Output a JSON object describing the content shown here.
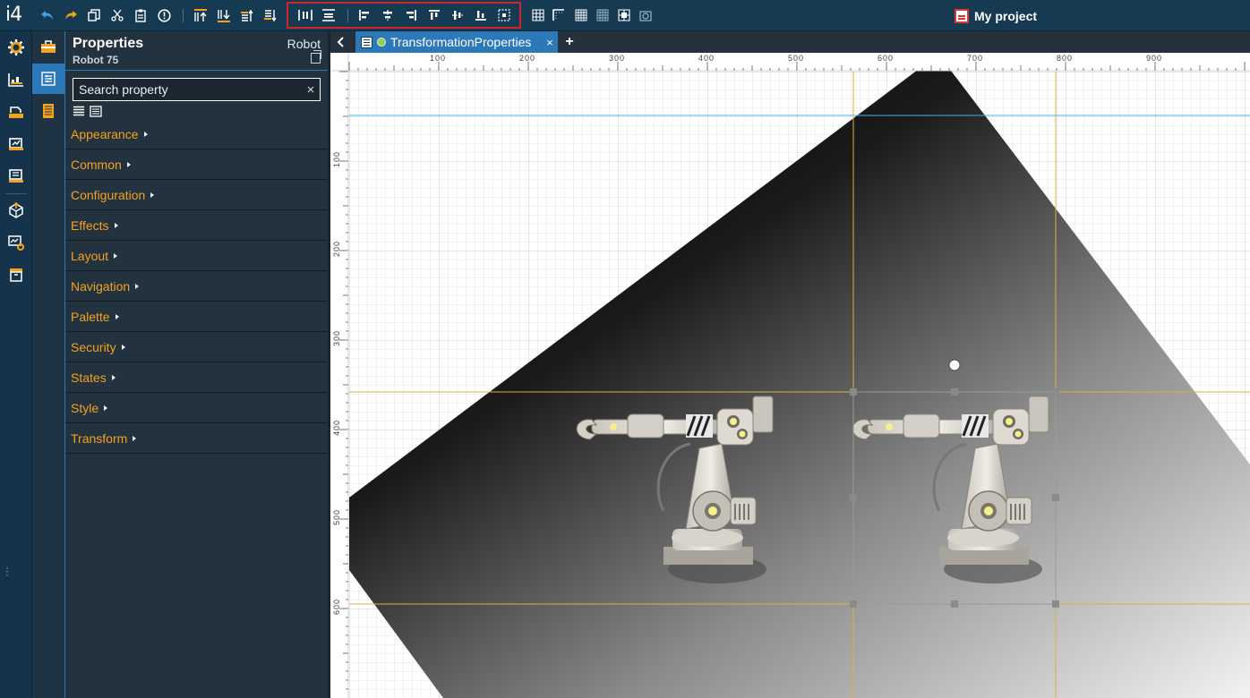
{
  "app": {
    "logo": "i4",
    "project_name": "My project"
  },
  "toolbar": {
    "icons": [
      "undo-icon",
      "redo-icon",
      "copy-icon",
      "cut-icon",
      "paste-icon",
      "info-icon",
      "bring-to-front-icon",
      "send-to-back-icon",
      "bring-forward-icon",
      "send-backward-icon",
      "distribute-horizontal-icon",
      "distribute-vertical-icon",
      "align-left-icon",
      "align-center-icon",
      "align-right-icon",
      "align-top-icon",
      "align-middle-icon",
      "align-bottom-icon",
      "align-to-selection-icon",
      "grid-icon",
      "snap-corner-icon",
      "grid-dense-icon",
      "grid-dots-icon",
      "snap-grid-icon",
      "snap-object-icon"
    ],
    "accent_color": "#f4a21e",
    "highlight_color": "#d0242a"
  },
  "left_rail": {
    "icons": [
      "settings-icon",
      "dashboard-icon",
      "hmi-icon",
      "reports-icon",
      "devices-icon",
      "deploy-icon",
      "monitor-icon",
      "archive-icon"
    ]
  },
  "sub_rail": {
    "icons": [
      "toolbox-icon",
      "properties-icon",
      "layers-icon"
    ]
  },
  "properties_panel": {
    "title": "Properties",
    "subtitle": "Robot 75",
    "object_type": "Robot",
    "search": {
      "value": "",
      "placeholder": "Search property",
      "clear": "×"
    },
    "categories": [
      "Appearance",
      "Common",
      "Configuration",
      "Effects",
      "Layout",
      "Navigation",
      "Palette",
      "Security",
      "States",
      "Style",
      "Transform"
    ]
  },
  "tabs": [
    {
      "label": "TransformationProperties",
      "close": "×",
      "status_color": "#8ed15a"
    }
  ],
  "tab_add": "+",
  "ruler": {
    "x_labels": [
      "100",
      "200",
      "300",
      "400",
      "500",
      "600",
      "700",
      "800",
      "900"
    ],
    "y_labels": [
      "100",
      "200",
      "300",
      "400",
      "500",
      "600"
    ]
  }
}
